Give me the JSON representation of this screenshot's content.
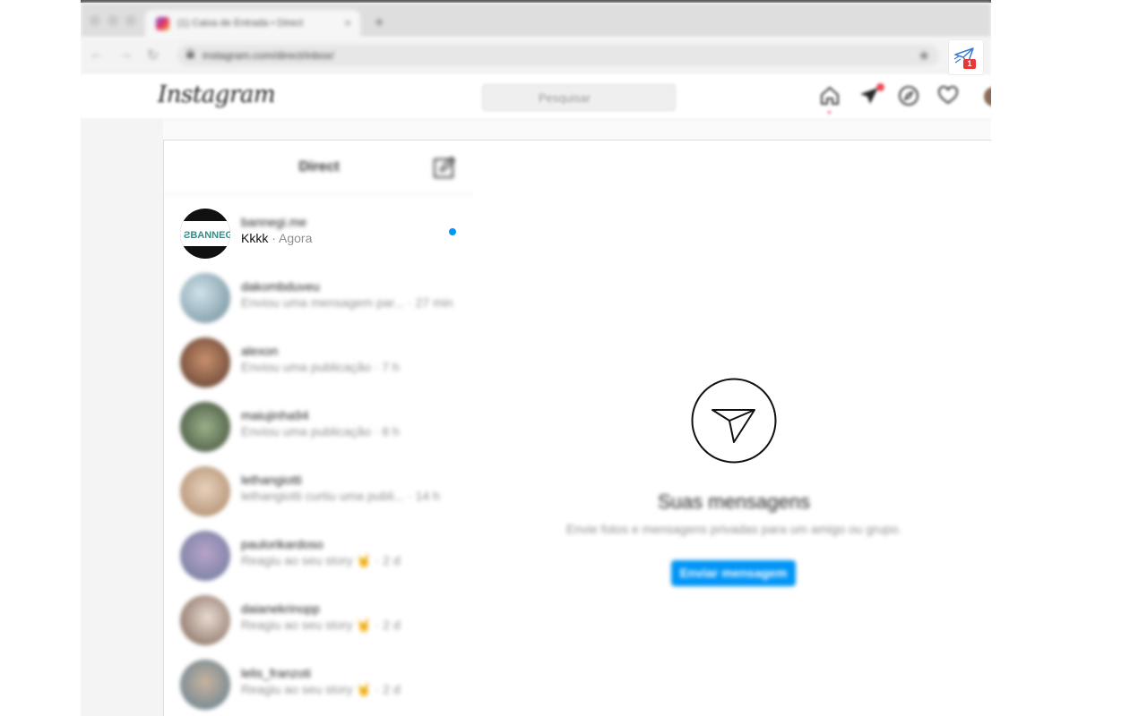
{
  "browser": {
    "tab_title": "(1) Caixa de Entrada • Direct",
    "url": "instagram.com/direct/inbox/",
    "new_tab": "+",
    "tab_close": "×"
  },
  "extension": {
    "icon": "paper-plane-icon",
    "badge": "1"
  },
  "header": {
    "logo": "Instagram",
    "search_placeholder": "Pesquisar",
    "icons": [
      "home-icon",
      "direct-icon",
      "explore-icon",
      "heart-icon",
      "avatar"
    ]
  },
  "inbox": {
    "title": "Direct",
    "conversations": [
      {
        "username": "bannegi.me",
        "message": "Kkkk",
        "sep": " · ",
        "time": "Agora",
        "unread": true
      },
      {
        "username": "dakombduveu",
        "message": "Enviou uma mensagem par...",
        "sep": " · ",
        "time": "27 min",
        "unread": false
      },
      {
        "username": "alexon",
        "message": "Enviou uma publicação",
        "sep": " · ",
        "time": "7 h",
        "unread": false
      },
      {
        "username": "maiujinha94",
        "message": "Enviou uma publicação",
        "sep": " · ",
        "time": "8 h",
        "unread": false
      },
      {
        "username": "lethangiotti",
        "message": "lethangiotti curtiu uma publi...",
        "sep": " · ",
        "time": "14 h",
        "unread": false
      },
      {
        "username": "paulorikardoso",
        "message": "Reagiu ao seu story 🤘",
        "sep": " · ",
        "time": "2 d",
        "unread": false
      },
      {
        "username": "daianekrinopp",
        "message": "Reagiu ao seu story 🤘",
        "sep": " · ",
        "time": "2 d",
        "unread": false
      },
      {
        "username": "lelis_franzoti",
        "message": "Reagiu ao seu story 🤘",
        "sep": " · ",
        "time": "2 d",
        "unread": false
      }
    ]
  },
  "empty_state": {
    "icon": "paper-plane-circle-icon",
    "title": "Suas mensagens",
    "subtitle": "Envie fotos e mensagens privadas para um amigo ou grupo.",
    "button": "Enviar mensagem"
  },
  "colors": {
    "accent": "#0095f6",
    "notification": "#ed4956",
    "badge": "#e53935"
  }
}
